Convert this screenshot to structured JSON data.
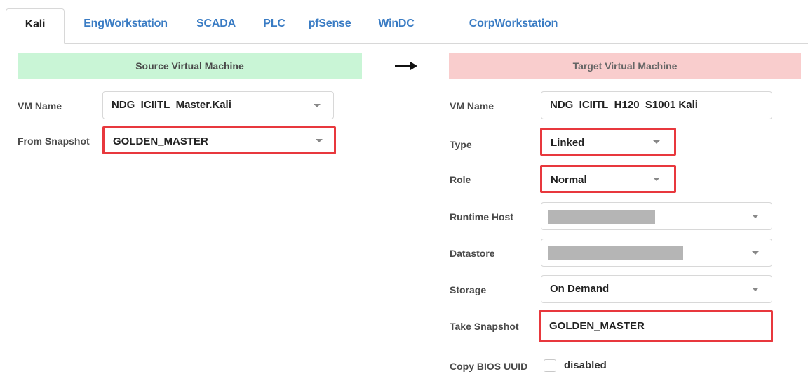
{
  "tabs": [
    {
      "label": "Kali",
      "active": true
    },
    {
      "label": "EngWorkstation",
      "active": false
    },
    {
      "label": "SCADA",
      "active": false
    },
    {
      "label": "PLC",
      "active": false
    },
    {
      "label": "pfSense",
      "active": false
    },
    {
      "label": "WinDC",
      "active": false
    },
    {
      "label": "CorpWorkstation",
      "active": false
    }
  ],
  "source": {
    "header": "Source Virtual Machine",
    "vm_name_label": "VM Name",
    "vm_name_value": "NDG_ICIITL_Master.Kali",
    "snapshot_label": "From Snapshot",
    "snapshot_value": "GOLDEN_MASTER"
  },
  "arrow_icon": "right-arrow-icon",
  "target": {
    "header": "Target Virtual Machine",
    "vm_name_label": "VM Name",
    "vm_name_value": "NDG_ICIITL_H120_S1001 Kali",
    "type_label": "Type",
    "type_value": "Linked",
    "role_label": "Role",
    "role_value": "Normal",
    "runtime_host_label": "Runtime Host",
    "datastore_label": "Datastore",
    "storage_label": "Storage",
    "storage_value": "On Demand",
    "take_snapshot_label": "Take Snapshot",
    "take_snapshot_value": "GOLDEN_MASTER",
    "copy_bios_label": "Copy BIOS UUID",
    "copy_bios_value": "disabled",
    "copy_bios_checked": false
  },
  "colors": {
    "tab_link": "#3a7cc4",
    "source_header_bg": "#c9f5d6",
    "target_header_bg": "#f9cdcd",
    "highlight": "#e8383d"
  }
}
